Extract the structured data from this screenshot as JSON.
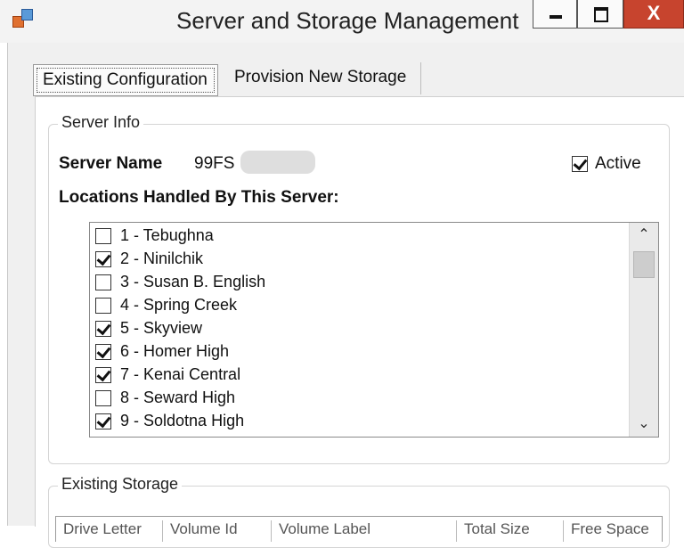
{
  "window": {
    "title": "Server and Storage Management",
    "close_symbol": "X"
  },
  "tabs": [
    {
      "label": "Existing Configuration",
      "selected": true
    },
    {
      "label": "Provision New Storage",
      "selected": false
    }
  ],
  "server_info": {
    "group_title": "Server Info",
    "server_name_label": "Server Name",
    "server_name_value": "99FS",
    "active_label": "Active",
    "active_checked": true,
    "locations_label": "Locations Handled By This Server:",
    "locations": [
      {
        "label": "1 - Tebughna",
        "checked": false
      },
      {
        "label": "2 - Ninilchik",
        "checked": true
      },
      {
        "label": "3 - Susan B. English",
        "checked": false
      },
      {
        "label": "4 - Spring Creek",
        "checked": false
      },
      {
        "label": "5 - Skyview",
        "checked": true
      },
      {
        "label": "6 - Homer High",
        "checked": true
      },
      {
        "label": "7 - Kenai Central",
        "checked": true
      },
      {
        "label": "8 - Seward High",
        "checked": false
      },
      {
        "label": "9 - Soldotna High",
        "checked": true
      }
    ]
  },
  "existing_storage": {
    "group_title": "Existing Storage",
    "columns": [
      "Drive Letter",
      "Volume Id",
      "Volume Label",
      "Total Size",
      "Free Space"
    ]
  },
  "icons": {
    "app": "app-windows-icon",
    "minimize": "minimize-icon",
    "maximize": "maximize-icon",
    "close": "close-icon",
    "scroll_up": "chevron-up-icon",
    "scroll_down": "chevron-down-icon"
  },
  "colors": {
    "close_button": "#c7442e",
    "titlebar": "#f3f3f3",
    "panel": "#ffffff"
  }
}
